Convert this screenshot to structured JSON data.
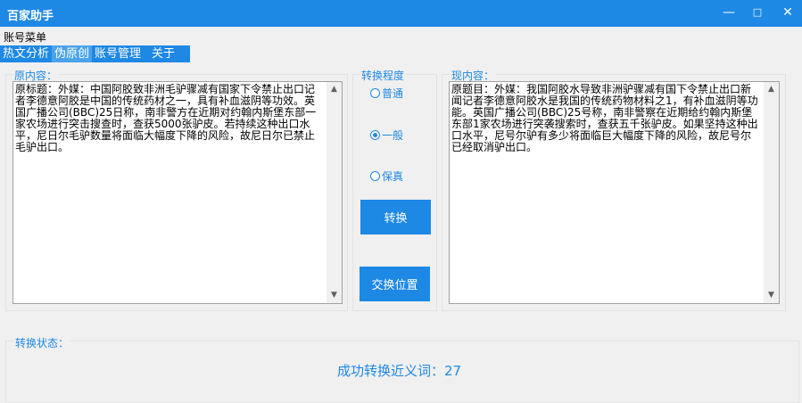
{
  "window": {
    "title": "百家助手",
    "minimize": "—",
    "maximize": "□",
    "close": "✕"
  },
  "menu": {
    "account_menu": "账号菜单"
  },
  "tabs": [
    {
      "label": "热文分析"
    },
    {
      "label": "伪原创"
    },
    {
      "label": "账号管理"
    },
    {
      "label": "关于"
    }
  ],
  "original": {
    "label": "原内容：",
    "text": "原标题：外媒：中国阿胶致非洲毛驴骤减有国家下令禁止出口记者李德意阿胶是中国的传统药材之一，具有补血滋阴等功效。英国广播公司(BBC)25日称，南非警方在近期对约翰内斯堡东部一家农场进行突击搜查时，查获5000张驴皮。若持续这种出口水平，尼日尔毛驴数量将面临大幅度下降的风险，故尼日尔已禁止毛驴出口。"
  },
  "degree": {
    "label": "转换程度",
    "options": [
      {
        "label": "普通",
        "selected": false
      },
      {
        "label": "一般",
        "selected": true
      },
      {
        "label": "保真",
        "selected": false
      }
    ]
  },
  "buttons": {
    "convert": "转换",
    "swap": "交换位置"
  },
  "result": {
    "label": "现内容：",
    "text": "原题目：外媒：我国阿胶水导致非洲驴骤减有国下令禁止出口新闻记者李德意阿胶水是我国的传统药物材料之1，有补血滋阴等功能。英国广播公司(BBC)25号称，南非警察在近期给约翰内斯堡东部1家农场进行突袭搜索时，查获五千张驴皮。如果坚持这种出口水平，尼号尔驴有多少将面临巨大幅度下降的风险，故尼号尔已经取消驴出口。"
  },
  "status": {
    "label": "转换状态：",
    "message": "成功转换近义词：27"
  }
}
